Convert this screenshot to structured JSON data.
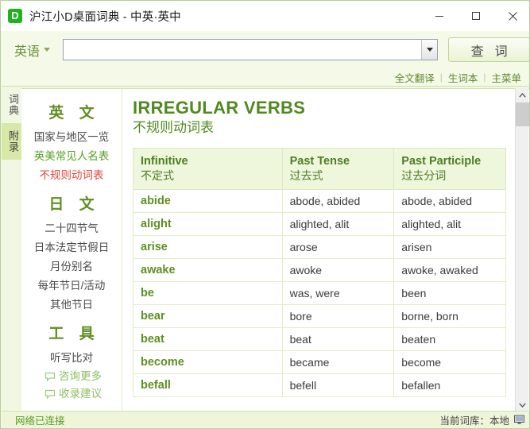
{
  "window": {
    "title": "沪江小D桌面词典 - 中英·英中",
    "app_icon_letter": "D",
    "app_icon_color": "#1fb41f",
    "controls": {
      "minimize": "minimize-icon",
      "maximize": "maximize-icon",
      "close": "close-icon"
    }
  },
  "search": {
    "language_label": "英语",
    "input_value": "",
    "input_placeholder": "",
    "dropdown_icon": "chevron-down-icon",
    "button_label": "查词"
  },
  "linkbar": {
    "links": [
      {
        "label": "全文翻译"
      },
      {
        "label": "生词本"
      },
      {
        "label": "主菜单"
      }
    ],
    "separator": "|"
  },
  "sidetabs": [
    {
      "label": "词典",
      "active": false
    },
    {
      "label": "附录",
      "active": true
    }
  ],
  "navpanel": {
    "sections": [
      {
        "heading": "英 文",
        "items": [
          {
            "label": "国家与地区一览",
            "state": "normal"
          },
          {
            "label": "英美常见人名表",
            "state": "hover"
          },
          {
            "label": "不规则动词表",
            "state": "selected"
          }
        ]
      },
      {
        "heading": "日 文",
        "items": [
          {
            "label": "二十四节气",
            "state": "normal"
          },
          {
            "label": "日本法定节假日",
            "state": "normal"
          },
          {
            "label": "月份别名",
            "state": "normal"
          },
          {
            "label": "每年节日/活动",
            "state": "normal"
          },
          {
            "label": "其他节日",
            "state": "normal"
          }
        ]
      },
      {
        "heading": "工 具",
        "items": [
          {
            "label": "听写比对",
            "state": "normal"
          }
        ]
      }
    ],
    "bubbles": [
      {
        "label": "咨询更多",
        "icon": "speech-bubble-icon"
      },
      {
        "label": "收录建议",
        "icon": "speech-bubble-icon"
      }
    ]
  },
  "article": {
    "title_en": "IRREGULAR VERBS",
    "title_cn": "不规则动词表",
    "table": {
      "headers": [
        {
          "en": "Infinitive",
          "cn": "不定式"
        },
        {
          "en": "Past Tense",
          "cn": "过去式"
        },
        {
          "en": "Past Participle",
          "cn": "过去分词"
        }
      ],
      "rows": [
        [
          "abide",
          "abode, abided",
          "abode, abided"
        ],
        [
          "alight",
          "alighted, alit",
          "alighted, alit"
        ],
        [
          "arise",
          "arose",
          "arisen"
        ],
        [
          "awake",
          "awoke",
          "awoke, awaked"
        ],
        [
          "be",
          "was, were",
          "been"
        ],
        [
          "bear",
          "bore",
          "borne, born"
        ],
        [
          "beat",
          "beat",
          "beaten"
        ],
        [
          "become",
          "became",
          "become"
        ],
        [
          "befall",
          "befell",
          "befallen"
        ]
      ]
    }
  },
  "statusbar": {
    "left_text": "网络已连接",
    "right_text": "当前词库：本地",
    "right_icon": "monitor-icon"
  },
  "colors": {
    "accent_green": "#5f8f22",
    "selected_red": "#e0483a",
    "hover_green": "#56a021",
    "panel_bg": "#f2f7e4",
    "tab_active": "#d8e8a8"
  }
}
